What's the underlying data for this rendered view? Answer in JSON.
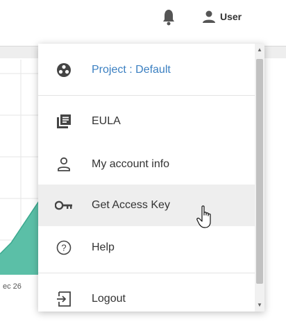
{
  "header": {
    "notifications_icon": "bell-icon",
    "user_icon": "person-icon",
    "user_label": "User"
  },
  "background": {
    "chart_tick_label": "ec 26",
    "area_color": "#5bbfa7"
  },
  "menu": {
    "items": [
      {
        "label": "Project : Default",
        "icon": "project-icon",
        "color": "#3a7fc1"
      },
      {
        "label": "EULA",
        "icon": "document-list-icon"
      },
      {
        "label": "My account info",
        "icon": "person-outline-icon"
      },
      {
        "label": "Get Access Key",
        "icon": "key-icon",
        "state": "hovered"
      },
      {
        "label": "Help",
        "icon": "help-circle-icon"
      },
      {
        "label": "Logout",
        "icon": "logout-icon"
      }
    ]
  }
}
